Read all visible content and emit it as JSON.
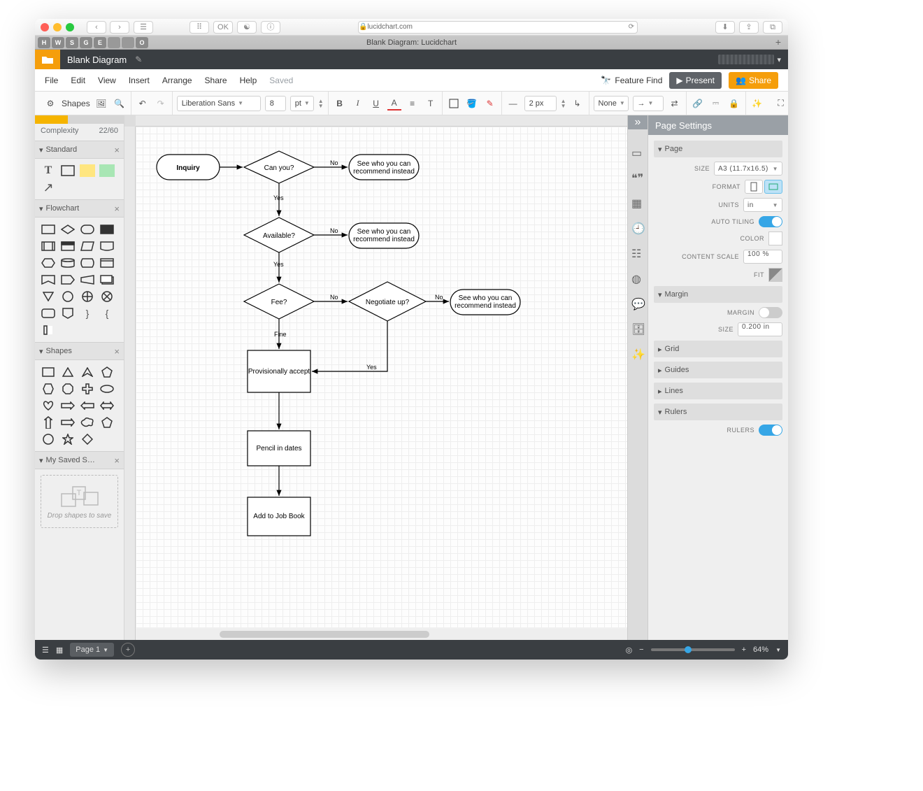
{
  "browser": {
    "url": "lucidchart.com",
    "tab_title": "Blank Diagram: Lucidchart"
  },
  "bookmarks": [
    "H",
    "W",
    "S",
    "G",
    "E",
    "",
    "",
    "O"
  ],
  "header": {
    "document_name": "Blank Diagram"
  },
  "menubar": {
    "items": [
      "File",
      "Edit",
      "View",
      "Insert",
      "Arrange",
      "Share",
      "Help"
    ],
    "status": "Saved",
    "feature_find": "Feature Find",
    "present": "Present",
    "share": "Share"
  },
  "toolbar": {
    "shapes_label": "Shapes",
    "font_family": "Liberation Sans",
    "font_size": "8",
    "font_unit": "pt",
    "stroke_width": "2 px",
    "line_start_style": "None"
  },
  "left_panel": {
    "complexity_label": "Complexity",
    "complexity_value": "22/60",
    "sections": {
      "standard": "Standard",
      "flowchart": "Flowchart",
      "shapes": "Shapes",
      "saved": "My Saved S…",
      "drop_hint": "Drop shapes to save"
    }
  },
  "right_panel": {
    "title": "Page Settings",
    "page": {
      "header": "Page",
      "size_label": "SIZE",
      "size_value": "A3 (11.7x16.5)",
      "format_label": "FORMAT",
      "units_label": "UNITS",
      "units_value": "in",
      "autotiling_label": "AUTO TILING",
      "color_label": "COLOR",
      "content_scale_label": "CONTENT SCALE",
      "content_scale_value": "100 %",
      "fit_label": "FIT"
    },
    "margin": {
      "header": "Margin",
      "margin_label": "MARGIN",
      "size_label": "SIZE",
      "size_value": "0.200 in"
    },
    "grid_header": "Grid",
    "guides_header": "Guides",
    "lines_header": "Lines",
    "rulers": {
      "header": "Rulers",
      "label": "RULERS"
    }
  },
  "statusbar": {
    "page": "Page 1",
    "zoom": "64%"
  },
  "flow": {
    "nodes": {
      "inquiry": "Inquiry",
      "can_you": "Can you?",
      "rec1": "See who you can recommend instead",
      "available": "Available?",
      "rec2": "See who you can recommend instead",
      "fee": "Fee?",
      "negotiate": "Negotiate up?",
      "rec3": "See who you can recommend instead",
      "provisionally": "Provisionally accept",
      "pencil": "Pencil in dates",
      "addjob": "Add to Job Book"
    },
    "edge_labels": {
      "no": "No",
      "yes": "Yes",
      "fine": "Fine"
    }
  }
}
